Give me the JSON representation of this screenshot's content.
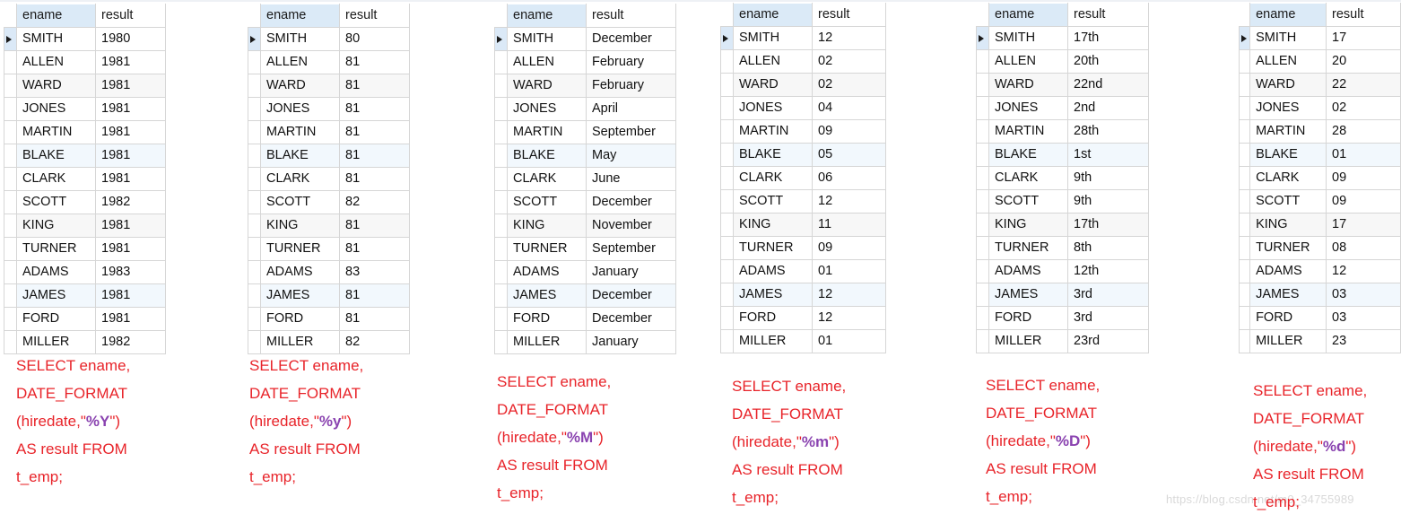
{
  "columns": [
    "ename",
    "result"
  ],
  "employees": [
    "SMITH",
    "ALLEN",
    "WARD",
    "JONES",
    "MARTIN",
    "BLAKE",
    "CLARK",
    "SCOTT",
    "KING",
    "TURNER",
    "ADAMS",
    "JAMES",
    "FORD",
    "MILLER"
  ],
  "watermark": "https://blog.csdn.net/m0_34755989",
  "panels": [
    {
      "id": "panel-year-full",
      "format_spec": "%Y",
      "sql": {
        "line1": "SELECT ename,",
        "line2": "DATE_FORMAT",
        "line3_pre": "(hiredate,\"",
        "line3_spec": "%Y",
        "line3_post": "\")",
        "line4": "AS result FROM",
        "line5": "t_emp;"
      },
      "results": [
        "1980",
        "1981",
        "1981",
        "1981",
        "1981",
        "1981",
        "1981",
        "1982",
        "1981",
        "1981",
        "1983",
        "1981",
        "1981",
        "1982"
      ]
    },
    {
      "id": "panel-year-short",
      "format_spec": "%y",
      "sql": {
        "line1": "SELECT ename,",
        "line2": "DATE_FORMAT",
        "line3_pre": "(hiredate,\"",
        "line3_spec": "%y",
        "line3_post": "\")",
        "line4": "AS result FROM",
        "line5": "t_emp;"
      },
      "results": [
        "80",
        "81",
        "81",
        "81",
        "81",
        "81",
        "81",
        "82",
        "81",
        "81",
        "83",
        "81",
        "81",
        "82"
      ]
    },
    {
      "id": "panel-month-name",
      "format_spec": "%M",
      "sql": {
        "line1": "SELECT ename,",
        "line2": "DATE_FORMAT",
        "line3_pre": "(hiredate,\"",
        "line3_spec": "%M",
        "line3_post": "\")",
        "line4": "AS result FROM",
        "line5": "t_emp;"
      },
      "results": [
        "December",
        "February",
        "February",
        "April",
        "September",
        "May",
        "June",
        "December",
        "November",
        "September",
        "January",
        "December",
        "December",
        "January"
      ]
    },
    {
      "id": "panel-month-num",
      "format_spec": "%m",
      "sql": {
        "line1": "SELECT ename,",
        "line2": "DATE_FORMAT",
        "line3_pre": "(hiredate,\"",
        "line3_spec": "%m",
        "line3_post": "\")",
        "line4": "AS result FROM",
        "line5": "t_emp;"
      },
      "results": [
        "12",
        "02",
        "02",
        "04",
        "09",
        "05",
        "06",
        "12",
        "11",
        "09",
        "01",
        "12",
        "12",
        "01"
      ]
    },
    {
      "id": "panel-day-ordinal",
      "format_spec": "%D",
      "sql": {
        "line1": "SELECT ename,",
        "line2": "DATE_FORMAT",
        "line3_pre": "(hiredate,\"",
        "line3_spec": "%D",
        "line3_post": "\")",
        "line4": "AS result FROM",
        "line5": "t_emp;"
      },
      "results": [
        "17th",
        "20th",
        "22nd",
        "2nd",
        "28th",
        "1st",
        "9th",
        "9th",
        "17th",
        "8th",
        "12th",
        "3rd",
        "3rd",
        "23rd"
      ]
    },
    {
      "id": "panel-day-num",
      "format_spec": "%d",
      "sql": {
        "line1": "SELECT ename,",
        "line2": "DATE_FORMAT",
        "line3_pre": "(hiredate,\"",
        "line3_spec": "%d",
        "line3_post": "\")",
        "line4": "AS result FROM",
        "line5": "t_emp;"
      },
      "results": [
        "17",
        "20",
        "22",
        "02",
        "28",
        "01",
        "09",
        "09",
        "17",
        "08",
        "12",
        "03",
        "03",
        "23"
      ]
    }
  ]
}
